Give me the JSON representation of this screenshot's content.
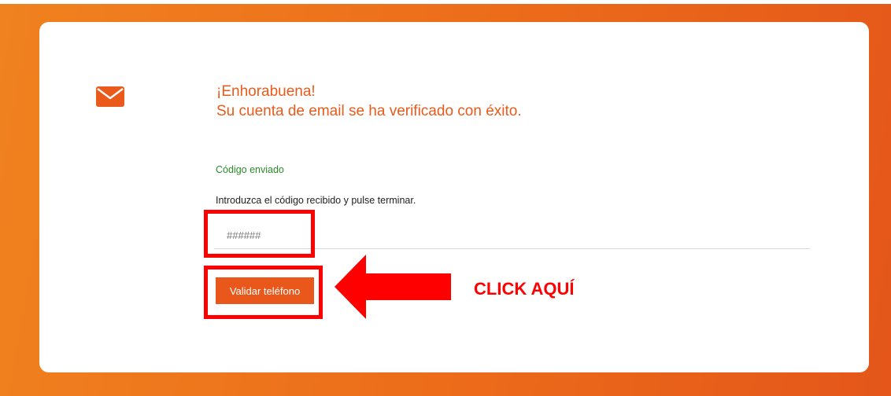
{
  "heading": {
    "line1": "¡Enhorabuena!",
    "line2": "Su cuenta de email se ha verificado con éxito."
  },
  "form": {
    "status": "Código enviado",
    "instructions": "Introduzca el código recibido y pulse terminar.",
    "code_placeholder": "######",
    "validate_label": "Validar teléfono"
  },
  "annotation": {
    "click_label": "CLICK AQUÍ"
  },
  "icons": {
    "mail": "envelope-icon",
    "arrow": "left-arrow-icon"
  },
  "colors": {
    "brand_orange": "#ea5a1a",
    "success_green": "#2a8a2a",
    "annotation_red": "#ff0000"
  }
}
